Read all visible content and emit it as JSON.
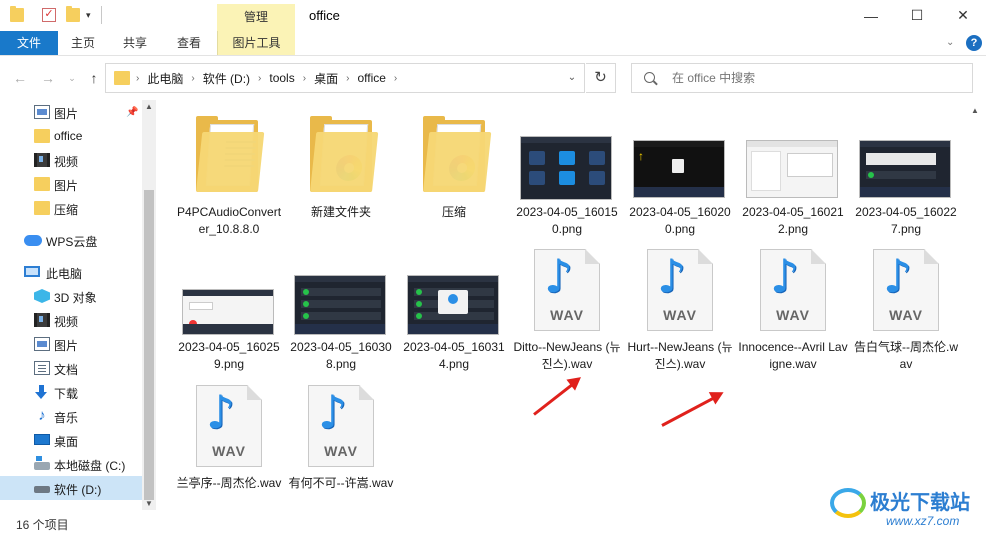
{
  "titlebar": {
    "title": "office",
    "manage_tab": "管理",
    "minimize": "—",
    "maximize": "☐",
    "close": "✕",
    "dropdown": "▾"
  },
  "ribbon": {
    "tabs": [
      "文件",
      "主页",
      "共享",
      "查看",
      "图片工具"
    ],
    "collapse": "⌄",
    "help": "?"
  },
  "address": {
    "crumbs": [
      "此电脑",
      "软件 (D:)",
      "tools",
      "桌面",
      "office"
    ],
    "separator": "›",
    "drop": "⌄",
    "refresh": "↻"
  },
  "search": {
    "placeholder": "在 office 中搜索"
  },
  "nav": {
    "quick": [
      {
        "label": "图片",
        "icon": "picture-icon"
      },
      {
        "label": "office",
        "icon": "folder-icon"
      },
      {
        "label": "视频",
        "icon": "video-icon"
      },
      {
        "label": "图片",
        "icon": "folder-icon"
      },
      {
        "label": "压缩",
        "icon": "folder-icon"
      }
    ],
    "wps": "WPS云盘",
    "pc": "此电脑",
    "pc_items": [
      {
        "label": "3D 对象",
        "icon": "3d-objects-icon"
      },
      {
        "label": "视频",
        "icon": "video-icon"
      },
      {
        "label": "图片",
        "icon": "picture-icon"
      },
      {
        "label": "文档",
        "icon": "document-icon"
      },
      {
        "label": "下载",
        "icon": "download-icon"
      },
      {
        "label": "音乐",
        "icon": "music-icon"
      },
      {
        "label": "桌面",
        "icon": "desktop-icon"
      },
      {
        "label": "本地磁盘 (C:)",
        "icon": "drive-c-icon"
      },
      {
        "label": "软件 (D:)",
        "icon": "drive-d-icon"
      }
    ]
  },
  "files": [
    {
      "name": "P4PCAudioConverter_10.8.8.0",
      "type": "folder"
    },
    {
      "name": "新建文件夹",
      "type": "folder"
    },
    {
      "name": "压缩",
      "type": "folder"
    },
    {
      "name": "2023-04-05_160150.png",
      "type": "image"
    },
    {
      "name": "2023-04-05_160200.png",
      "type": "image"
    },
    {
      "name": "2023-04-05_160212.png",
      "type": "image"
    },
    {
      "name": "2023-04-05_160227.png",
      "type": "image"
    },
    {
      "name": "2023-04-05_160259.png",
      "type": "image"
    },
    {
      "name": "2023-04-05_160308.png",
      "type": "image"
    },
    {
      "name": "2023-04-05_160314.png",
      "type": "image"
    },
    {
      "name": "Ditto--NewJeans (뉴진스).wav",
      "type": "wav"
    },
    {
      "name": "Hurt--NewJeans (뉴진스).wav",
      "type": "wav"
    },
    {
      "name": "Innocence--Avril Lavigne.wav",
      "type": "wav"
    },
    {
      "name": "告白气球--周杰伦.wav",
      "type": "wav"
    },
    {
      "name": "兰亭序--周杰伦.wav",
      "type": "wav"
    },
    {
      "name": "有何不可--许嵩.wav",
      "type": "wav"
    }
  ],
  "wav_label": "WAV",
  "status": {
    "count": "16 个项目"
  },
  "watermark": {
    "title": "极光下载站",
    "url": "www.xz7.com"
  },
  "colors": {
    "accent": "#1979ca",
    "manage": "#fbf3b6",
    "arrow": "#e0211c",
    "selected": "#cce4f7"
  }
}
